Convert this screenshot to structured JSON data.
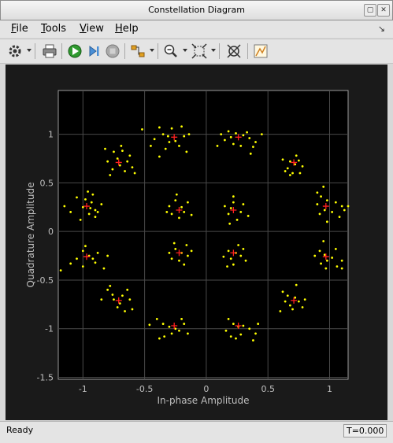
{
  "window": {
    "title": "Constellation Diagram"
  },
  "menu": [
    {
      "key": "F",
      "rest": "ile"
    },
    {
      "key": "T",
      "rest": "ools"
    },
    {
      "key": "V",
      "rest": "iew"
    },
    {
      "key": "H",
      "rest": "elp"
    }
  ],
  "toolbar": {
    "icons": [
      "settings-icon",
      "print-icon",
      "run-icon",
      "step-icon",
      "stop-icon",
      "highlight-icon",
      "zoom-icon",
      "autoscale-icon",
      "cursors-icon",
      "style-icon"
    ]
  },
  "status": {
    "left": "Ready",
    "right": "T=0.000"
  },
  "colors": {
    "plot_bg": "#000000",
    "axes_text": "#bfbfbf",
    "grid": "#4a4a4a",
    "received": "#ffff00",
    "reference": "#ff2020"
  },
  "chart_data": {
    "type": "scatter",
    "xlabel": "In-phase Amplitude",
    "ylabel": "Quadrature Amplitude",
    "xlim": [
      -1.2,
      1.15
    ],
    "ylim": [
      -1.52,
      1.45
    ],
    "xticks": [
      -1,
      -0.5,
      0,
      0.5,
      1
    ],
    "xtick_labels": [
      "-1",
      "-0.5",
      "0",
      "0.5",
      "1"
    ],
    "yticks": [
      -1.5,
      -1,
      -0.5,
      0,
      0.5,
      1
    ],
    "ytick_labels": [
      "-1.5",
      "-1",
      "-0.5",
      "0",
      "0.5",
      "1"
    ],
    "grid": true,
    "reference_points": [
      [
        -0.26,
        0.97
      ],
      [
        0.26,
        0.97
      ],
      [
        -0.71,
        0.71
      ],
      [
        0.71,
        0.71
      ],
      [
        -0.97,
        0.26
      ],
      [
        0.97,
        0.26
      ],
      [
        -0.97,
        -0.26
      ],
      [
        0.97,
        -0.26
      ],
      [
        -0.71,
        -0.71
      ],
      [
        0.71,
        -0.71
      ],
      [
        -0.26,
        -0.97
      ],
      [
        0.26,
        -0.97
      ],
      [
        -0.22,
        0.22
      ],
      [
        0.22,
        0.22
      ],
      [
        -0.22,
        -0.22
      ],
      [
        0.22,
        -0.22
      ]
    ],
    "received_points": [
      [
        -0.52,
        1.05
      ],
      [
        -0.38,
        1.07
      ],
      [
        -0.28,
        1.06
      ],
      [
        -0.2,
        1.08
      ],
      [
        -0.35,
        1.0
      ],
      [
        -0.3,
        0.92
      ],
      [
        -0.18,
        0.98
      ],
      [
        -0.42,
        0.95
      ],
      [
        -0.22,
        0.88
      ],
      [
        -0.33,
        0.85
      ],
      [
        -0.38,
        0.77
      ],
      [
        -0.16,
        0.82
      ],
      [
        -0.45,
        0.88
      ],
      [
        -0.25,
        0.93
      ],
      [
        -0.14,
        1.0
      ],
      [
        -0.31,
        0.98
      ],
      [
        0.12,
        1.0
      ],
      [
        0.18,
        1.03
      ],
      [
        0.24,
        1.01
      ],
      [
        0.3,
        0.99
      ],
      [
        0.35,
        0.96
      ],
      [
        0.4,
        0.92
      ],
      [
        0.22,
        0.9
      ],
      [
        0.15,
        0.94
      ],
      [
        0.28,
        0.88
      ],
      [
        0.38,
        0.87
      ],
      [
        0.45,
        1.0
      ],
      [
        0.2,
        0.97
      ],
      [
        0.33,
        1.02
      ],
      [
        0.09,
        0.88
      ],
      [
        0.36,
        0.8
      ],
      [
        -0.75,
        0.82
      ],
      [
        -0.68,
        0.83
      ],
      [
        -0.8,
        0.72
      ],
      [
        -0.72,
        0.75
      ],
      [
        -0.64,
        0.72
      ],
      [
        -0.76,
        0.64
      ],
      [
        -0.66,
        0.62
      ],
      [
        -0.6,
        0.66
      ],
      [
        -0.7,
        0.68
      ],
      [
        -0.82,
        0.85
      ],
      [
        -0.62,
        0.78
      ],
      [
        -0.58,
        0.6
      ],
      [
        -0.78,
        0.58
      ],
      [
        -0.69,
        0.88
      ],
      [
        0.62,
        0.74
      ],
      [
        0.68,
        0.72
      ],
      [
        0.72,
        0.69
      ],
      [
        0.75,
        0.73
      ],
      [
        0.66,
        0.65
      ],
      [
        0.7,
        0.6
      ],
      [
        0.78,
        0.67
      ],
      [
        0.64,
        0.62
      ],
      [
        0.73,
        0.78
      ],
      [
        0.68,
        0.58
      ],
      [
        0.76,
        0.6
      ],
      [
        -1.05,
        0.35
      ],
      [
        -0.98,
        0.33
      ],
      [
        -0.93,
        0.3
      ],
      [
        -0.9,
        0.22
      ],
      [
        -0.95,
        0.18
      ],
      [
        -1.0,
        0.25
      ],
      [
        -0.92,
        0.38
      ],
      [
        -1.1,
        0.2
      ],
      [
        -0.85,
        0.28
      ],
      [
        -0.9,
        0.15
      ],
      [
        -1.02,
        0.12
      ],
      [
        -0.96,
        0.41
      ],
      [
        -0.88,
        0.2
      ],
      [
        -1.15,
        0.26
      ],
      [
        -0.94,
        0.24
      ],
      [
        0.9,
        0.4
      ],
      [
        0.93,
        0.36
      ],
      [
        0.98,
        0.32
      ],
      [
        1.05,
        0.3
      ],
      [
        1.1,
        0.26
      ],
      [
        0.96,
        0.22
      ],
      [
        1.02,
        0.2
      ],
      [
        1.12,
        0.22
      ],
      [
        0.92,
        0.18
      ],
      [
        0.98,
        0.1
      ],
      [
        1.08,
        0.15
      ],
      [
        0.9,
        0.28
      ],
      [
        1.15,
        0.26
      ],
      [
        0.95,
        0.46
      ],
      [
        -1.0,
        -0.2
      ],
      [
        -1.05,
        -0.28
      ],
      [
        -0.95,
        -0.25
      ],
      [
        -0.92,
        -0.28
      ],
      [
        -1.1,
        -0.33
      ],
      [
        -0.9,
        -0.32
      ],
      [
        -0.83,
        -0.38
      ],
      [
        -1.18,
        -0.4
      ],
      [
        -0.98,
        -0.15
      ],
      [
        -0.88,
        -0.22
      ],
      [
        -1.0,
        -0.36
      ],
      [
        -0.8,
        -0.25
      ],
      [
        0.92,
        -0.2
      ],
      [
        0.96,
        -0.24
      ],
      [
        0.98,
        -0.3
      ],
      [
        1.02,
        -0.27
      ],
      [
        1.06,
        -0.36
      ],
      [
        0.93,
        -0.33
      ],
      [
        1.1,
        -0.3
      ],
      [
        0.88,
        -0.25
      ],
      [
        0.95,
        -0.1
      ],
      [
        1.05,
        -0.18
      ],
      [
        0.97,
        -0.38
      ],
      [
        1.1,
        -0.38
      ],
      [
        -0.8,
        -0.6
      ],
      [
        -0.76,
        -0.65
      ],
      [
        -0.75,
        -0.7
      ],
      [
        -0.7,
        -0.74
      ],
      [
        -0.68,
        -0.66
      ],
      [
        -0.62,
        -0.7
      ],
      [
        -0.66,
        -0.82
      ],
      [
        -0.85,
        -0.7
      ],
      [
        -0.6,
        -0.8
      ],
      [
        -0.72,
        -0.78
      ],
      [
        -0.78,
        -0.56
      ],
      [
        -0.64,
        -0.6
      ],
      [
        0.62,
        -0.62
      ],
      [
        0.66,
        -0.66
      ],
      [
        0.72,
        -0.68
      ],
      [
        0.75,
        -0.72
      ],
      [
        0.68,
        -0.76
      ],
      [
        0.6,
        -0.82
      ],
      [
        0.7,
        -0.8
      ],
      [
        0.8,
        -0.7
      ],
      [
        0.73,
        -0.55
      ],
      [
        0.78,
        -0.78
      ],
      [
        0.64,
        -0.72
      ],
      [
        -0.4,
        -0.9
      ],
      [
        -0.35,
        -0.95
      ],
      [
        -0.3,
        -0.98
      ],
      [
        -0.25,
        -1.0
      ],
      [
        -0.28,
        -1.05
      ],
      [
        -0.34,
        -1.08
      ],
      [
        -0.18,
        -0.95
      ],
      [
        -0.22,
        -1.02
      ],
      [
        -0.15,
        -1.05
      ],
      [
        -0.38,
        -1.1
      ],
      [
        -0.46,
        -0.96
      ],
      [
        -0.2,
        -0.9
      ],
      [
        0.18,
        -0.9
      ],
      [
        0.22,
        -0.95
      ],
      [
        0.26,
        -0.98
      ],
      [
        0.3,
        -0.97
      ],
      [
        0.35,
        -1.0
      ],
      [
        0.28,
        -1.06
      ],
      [
        0.2,
        -1.08
      ],
      [
        0.4,
        -1.05
      ],
      [
        0.42,
        -0.95
      ],
      [
        0.16,
        -1.02
      ],
      [
        0.24,
        -1.1
      ],
      [
        0.38,
        -1.12
      ],
      [
        -0.3,
        0.26
      ],
      [
        -0.25,
        0.32
      ],
      [
        -0.2,
        0.25
      ],
      [
        -0.18,
        0.2
      ],
      [
        -0.12,
        0.17
      ],
      [
        -0.28,
        0.18
      ],
      [
        -0.22,
        0.14
      ],
      [
        -0.15,
        0.3
      ],
      [
        -0.32,
        0.2
      ],
      [
        -0.24,
        0.38
      ],
      [
        0.2,
        0.24
      ],
      [
        0.22,
        0.3
      ],
      [
        0.18,
        0.18
      ],
      [
        0.28,
        0.2
      ],
      [
        0.3,
        0.28
      ],
      [
        0.15,
        0.26
      ],
      [
        0.25,
        0.12
      ],
      [
        0.34,
        0.16
      ],
      [
        0.22,
        0.36
      ],
      [
        0.19,
        0.08
      ],
      [
        -0.25,
        -0.18
      ],
      [
        -0.2,
        -0.22
      ],
      [
        -0.15,
        -0.25
      ],
      [
        -0.28,
        -0.28
      ],
      [
        -0.22,
        -0.3
      ],
      [
        -0.12,
        -0.2
      ],
      [
        -0.3,
        -0.22
      ],
      [
        -0.18,
        -0.34
      ],
      [
        -0.26,
        -0.12
      ],
      [
        -0.16,
        -0.14
      ],
      [
        0.18,
        -0.2
      ],
      [
        0.24,
        -0.22
      ],
      [
        0.2,
        -0.28
      ],
      [
        0.28,
        -0.25
      ],
      [
        0.14,
        -0.26
      ],
      [
        0.3,
        -0.18
      ],
      [
        0.22,
        -0.34
      ],
      [
        0.26,
        -0.14
      ],
      [
        0.17,
        -0.36
      ],
      [
        0.32,
        -0.3
      ]
    ]
  }
}
